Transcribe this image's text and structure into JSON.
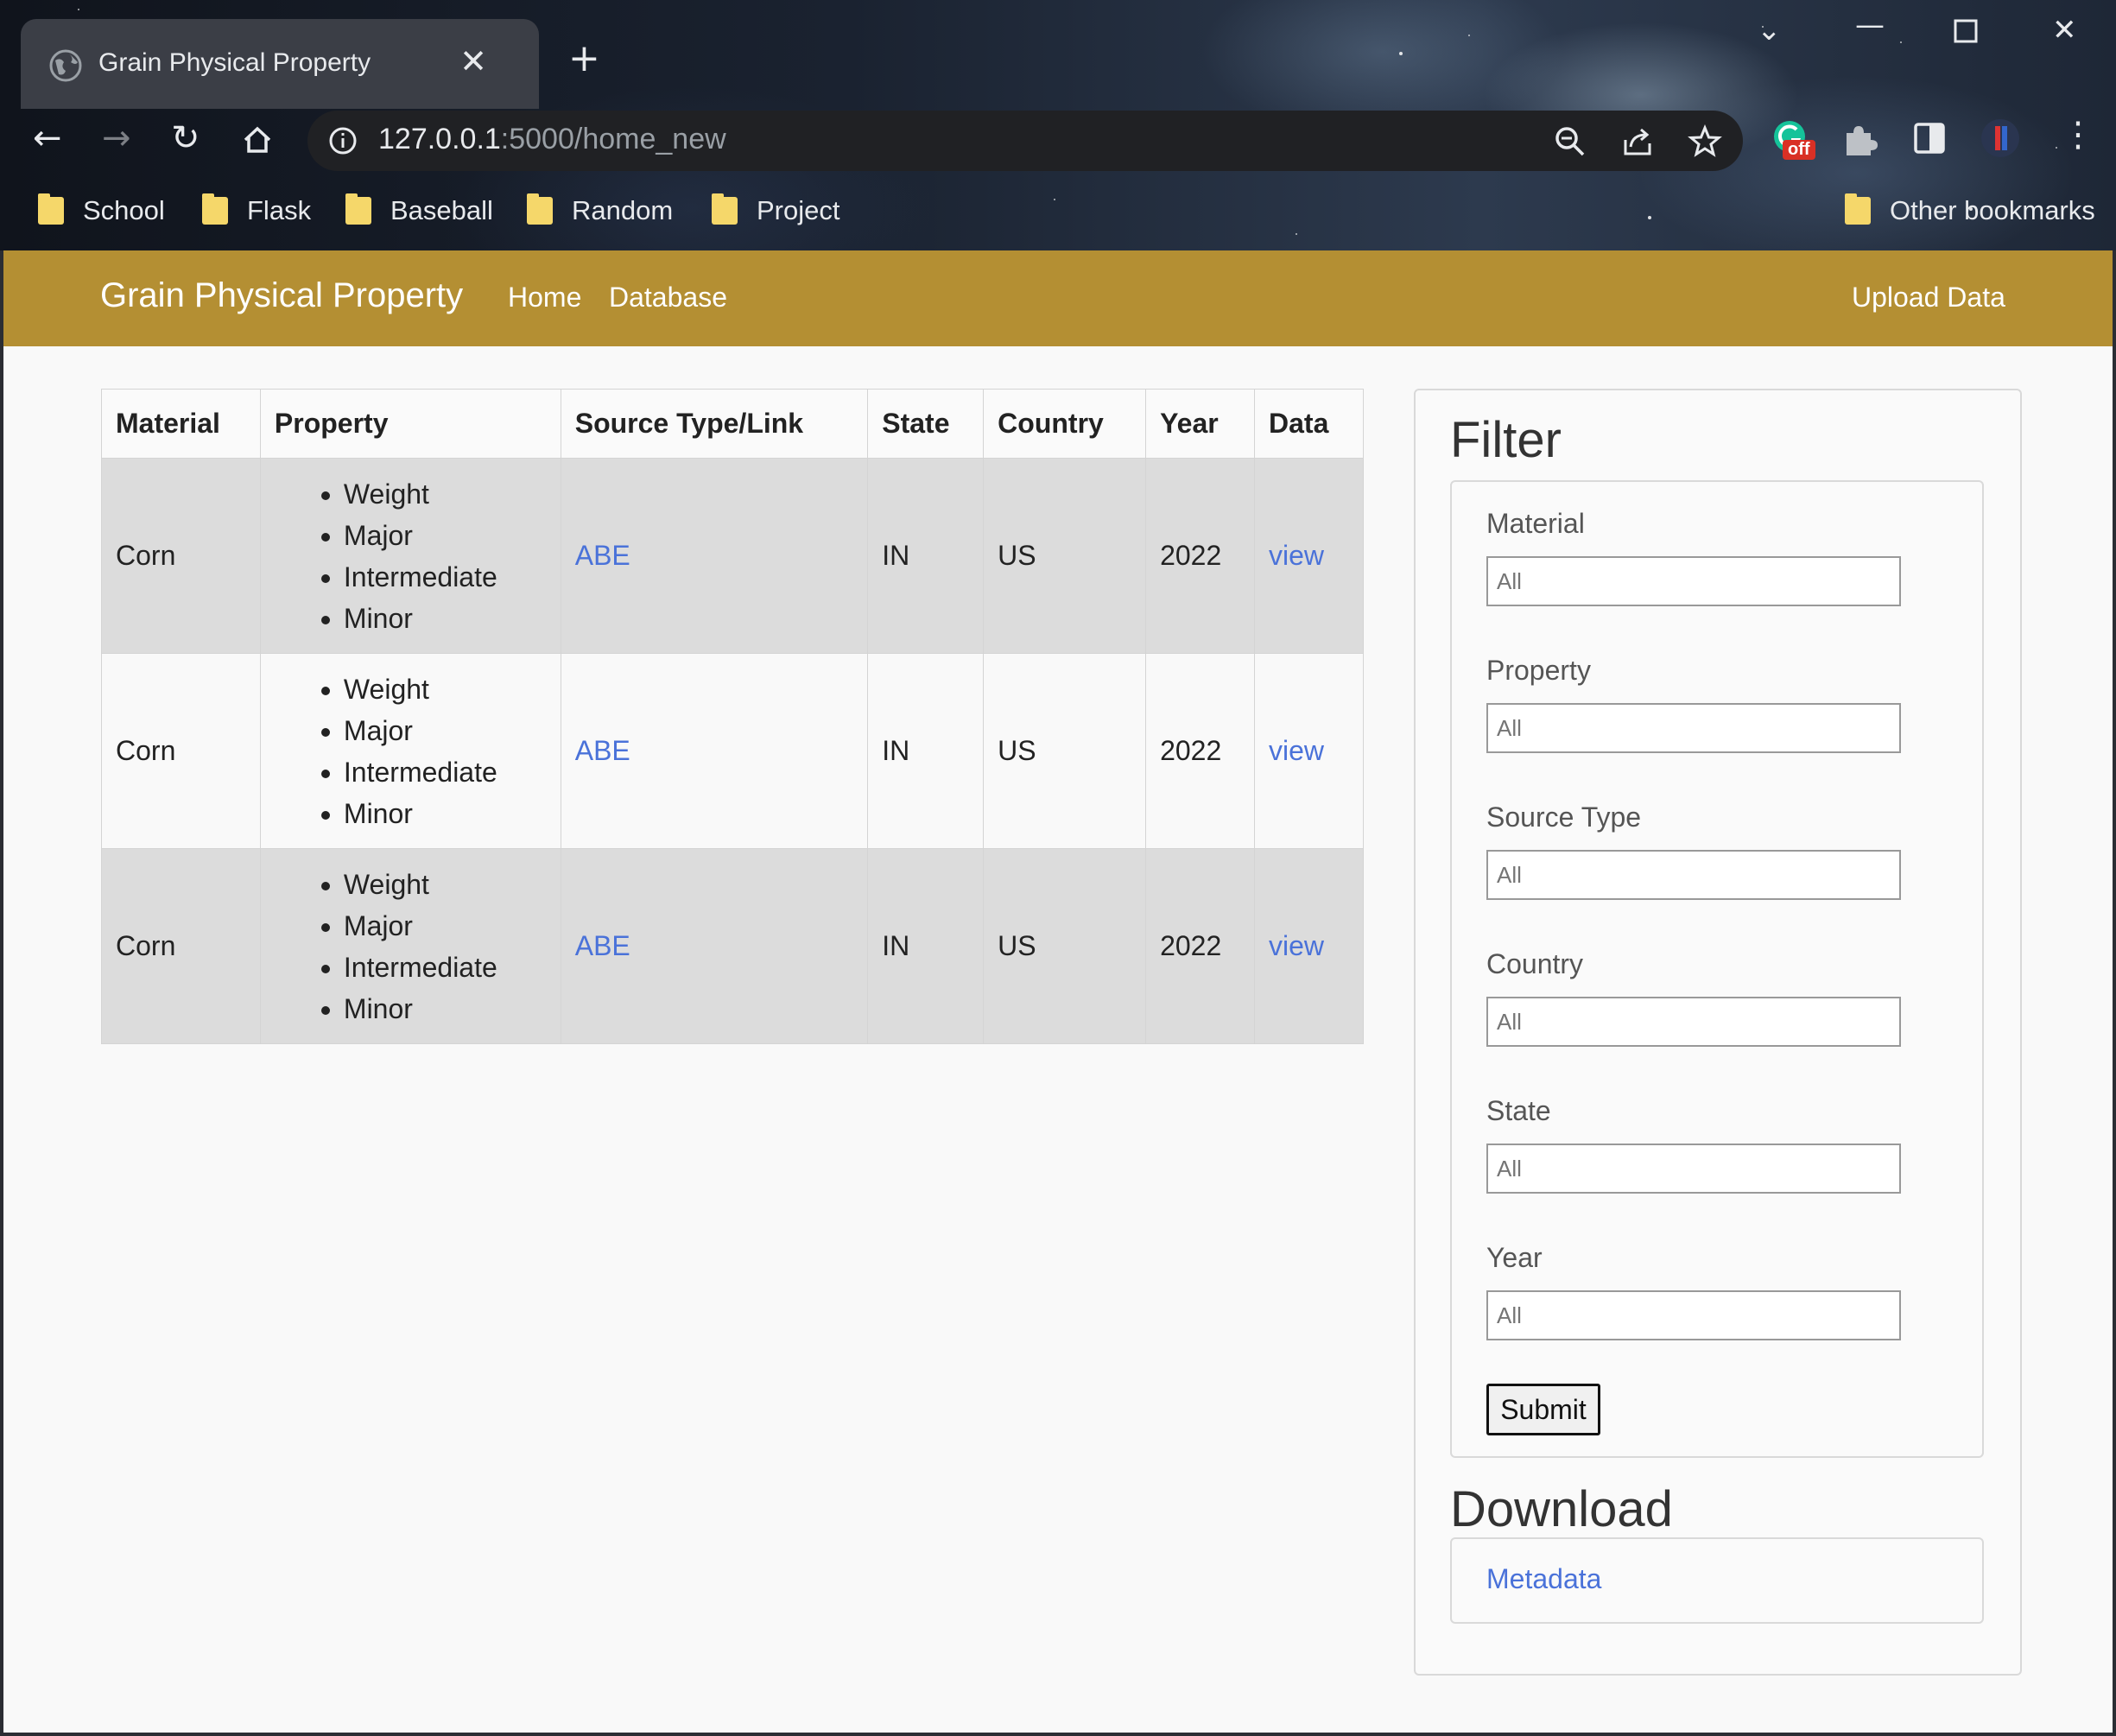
{
  "browser": {
    "tab_title": "Grain Physical Property",
    "url_host": "127.0.0.1",
    "url_rest": ":5000/home_new",
    "extension_badge": "off",
    "bookmarks": [
      "School",
      "Flask",
      "Baseball",
      "Random",
      "Project"
    ],
    "other_bookmarks": "Other bookmarks"
  },
  "navbar": {
    "brand": "Grain Physical Property",
    "links": [
      "Home",
      "Database"
    ],
    "upload": "Upload Data",
    "color": "#b48f33"
  },
  "table": {
    "headers": [
      "Material",
      "Property",
      "Source Type/Link",
      "State",
      "Country",
      "Year",
      "Data"
    ],
    "rows": [
      {
        "material": "Corn",
        "properties": [
          "Weight",
          "Major",
          "Intermediate",
          "Minor"
        ],
        "source": "ABE",
        "state": "IN",
        "country": "US",
        "year": "2022",
        "data": "view"
      },
      {
        "material": "Corn",
        "properties": [
          "Weight",
          "Major",
          "Intermediate",
          "Minor"
        ],
        "source": "ABE",
        "state": "IN",
        "country": "US",
        "year": "2022",
        "data": "view"
      },
      {
        "material": "Corn",
        "properties": [
          "Weight",
          "Major",
          "Intermediate",
          "Minor"
        ],
        "source": "ABE",
        "state": "IN",
        "country": "US",
        "year": "2022",
        "data": "view"
      }
    ]
  },
  "filter": {
    "heading": "Filter",
    "fields": [
      {
        "label": "Material",
        "placeholder": "All"
      },
      {
        "label": "Property",
        "placeholder": "All"
      },
      {
        "label": "Source Type",
        "placeholder": "All"
      },
      {
        "label": "Country",
        "placeholder": "All"
      },
      {
        "label": "State",
        "placeholder": "All"
      },
      {
        "label": "Year",
        "placeholder": "All"
      }
    ],
    "submit": "Submit"
  },
  "download": {
    "heading": "Download",
    "link": "Metadata"
  },
  "colors": {
    "link": "#4a72d9",
    "row_odd": "#dcdcdc"
  }
}
